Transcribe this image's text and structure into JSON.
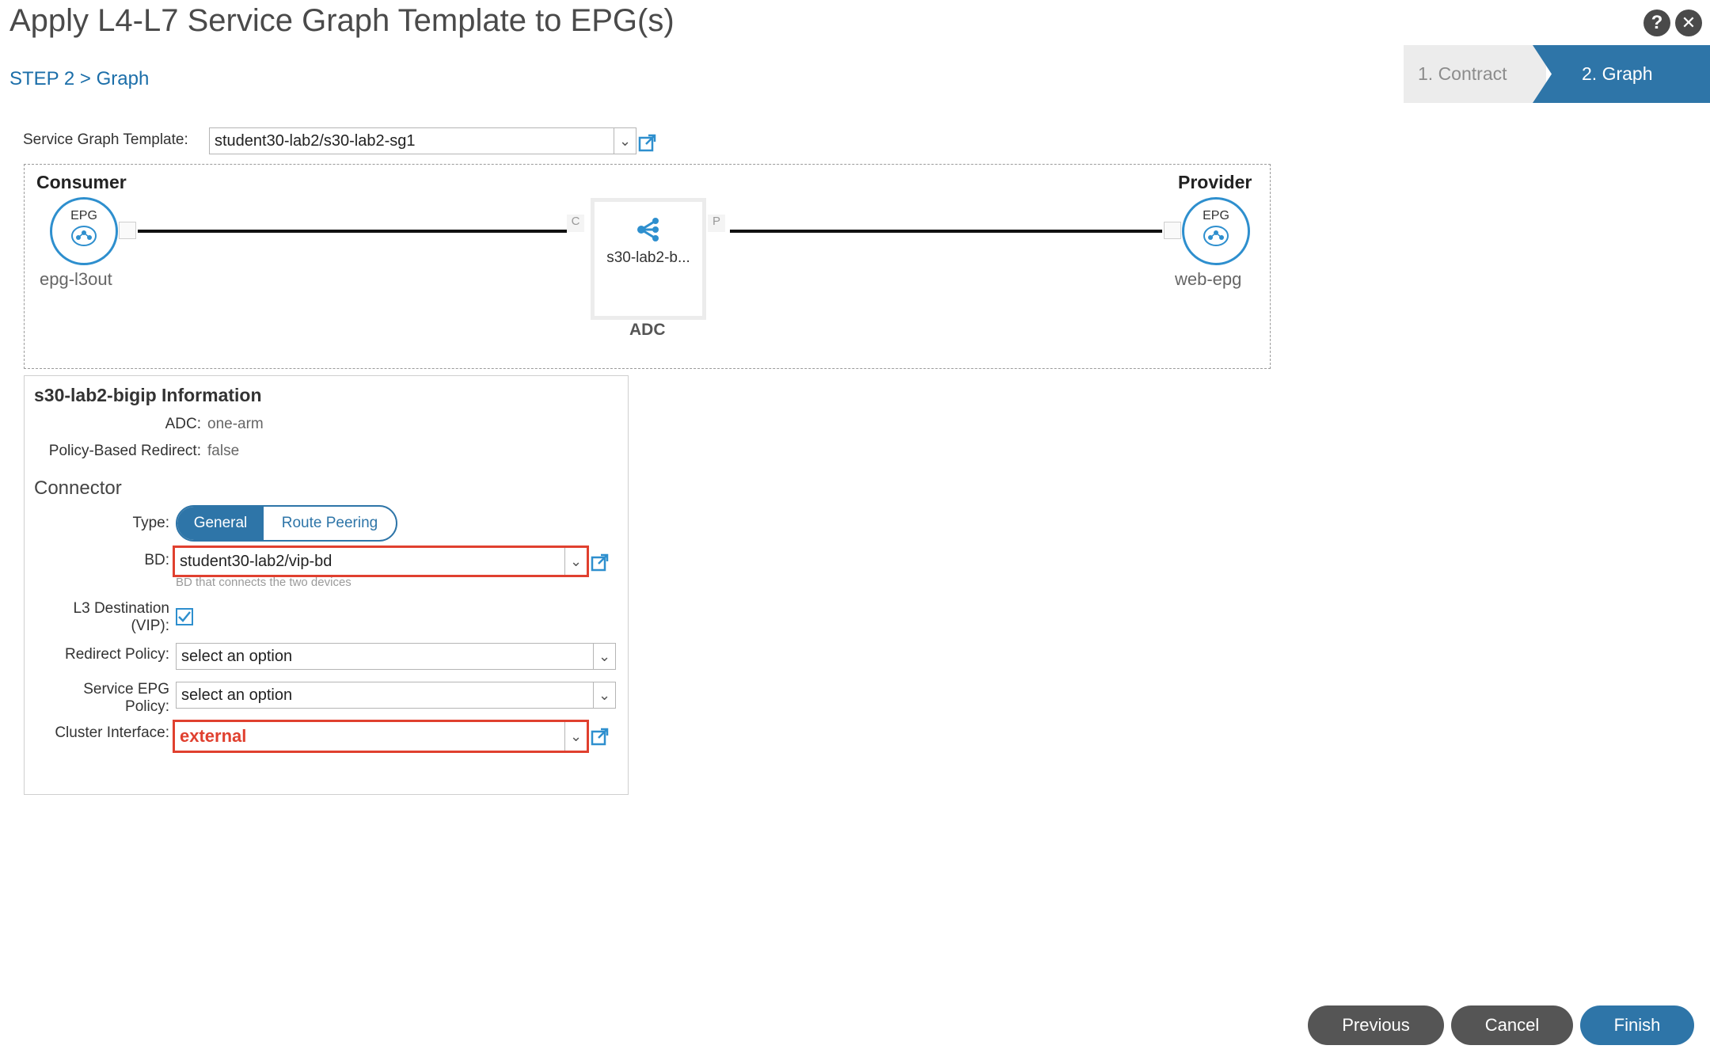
{
  "header": {
    "title": "Apply L4-L7 Service Graph Template to EPG(s)",
    "breadcrumb": "STEP 2 > Graph",
    "help_label": "?",
    "close_label": "✕"
  },
  "wizard": {
    "steps": [
      {
        "label": "1. Contract",
        "active": false
      },
      {
        "label": "2. Graph",
        "active": true
      }
    ]
  },
  "template": {
    "label": "Service Graph Template:",
    "value": "student30-lab2/s30-lab2-sg1"
  },
  "graph": {
    "consumer": {
      "heading": "Consumer",
      "badge": "EPG",
      "name": "epg-l3out"
    },
    "provider": {
      "heading": "Provider",
      "badge": "EPG",
      "name": "web-epg"
    },
    "node": {
      "name": "s30-lab2-b...",
      "type": "ADC",
      "consumer_port": "C",
      "provider_port": "P"
    }
  },
  "info": {
    "title": "s30-lab2-bigip Information",
    "adc_label": "ADC:",
    "adc_value": "one-arm",
    "pbr_label": "Policy-Based Redirect:",
    "pbr_value": "false",
    "connector_heading": "Connector",
    "type_label": "Type:",
    "type_options": [
      "General",
      "Route Peering"
    ],
    "type_selected": "General",
    "bd_label": "BD:",
    "bd_value": "student30-lab2/vip-bd",
    "bd_hint": "BD that connects the two devices",
    "l3_label_1": "L3 Destination",
    "l3_label_2": "(VIP):",
    "l3_checked": true,
    "redirect_label": "Redirect Policy:",
    "redirect_value": "select an option",
    "sepg_label_1": "Service EPG",
    "sepg_label_2": "Policy:",
    "sepg_value": "select an option",
    "cluster_label": "Cluster Interface:",
    "cluster_value": "external"
  },
  "footer": {
    "previous": "Previous",
    "cancel": "Cancel",
    "finish": "Finish"
  },
  "colors": {
    "accent": "#2e75a8",
    "highlight": "#e0402f",
    "button_gray": "#555555"
  },
  "icons": [
    "help-icon",
    "close-icon",
    "external-link-icon",
    "epg-icon",
    "service-node-icon",
    "chevron-down-icon",
    "checkmark-icon"
  ]
}
